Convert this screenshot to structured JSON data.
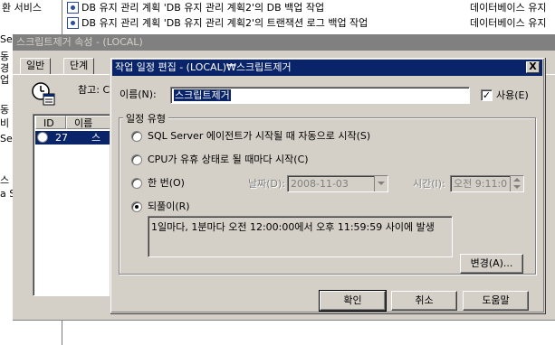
{
  "background": {
    "rows": [
      {
        "col1": "환 서비스",
        "job": "DB 유지 관리 계획 'DB 유지 관리 계획2'의 DB 백업 작업",
        "category": "데이터베이스 유지"
      },
      {
        "col1": "",
        "job": "DB 유지 관리 계획 'DB 유지 관리 계획2'의 트랜잭션 로그 백업 작업",
        "category": "데이터베이스 유지"
      }
    ],
    "left_fragments": [
      "Se",
      "동",
      "경",
      "업",
      "동",
      "비",
      "Se",
      "스",
      "a S"
    ]
  },
  "properties_window": {
    "title": "스크립트제거 속성 - (LOCAL)",
    "tabs": [
      "일반",
      "단계"
    ],
    "note_label": "참고: C",
    "list_headers": [
      "ID",
      "이름"
    ],
    "list_row": {
      "id": "27",
      "name": "스"
    }
  },
  "dialog": {
    "title": "작업 일정 편집 - (LOCAL)₩스크립트제거",
    "close_label": "X",
    "name_label": "이름(N):",
    "name_value": "스크립트제거",
    "enabled_label": "사용(E)",
    "enabled_checked": true,
    "schedule_group_label": "일정 유형",
    "options": {
      "sql_agent_start": "SQL Server 에이전트가 시작될 때 자동으로 시작(S)",
      "cpu_idle": "CPU가 유휴 상태로 될 때마다 시작(C)",
      "once": "한 번(O)",
      "recurring": "되풀이(R)"
    },
    "selected_option": "recurring",
    "date_label": "날짜(D):",
    "date_value": "2008-11-03",
    "time_label": "시간(I):",
    "time_value": "오전  9:11:0",
    "recurring_description": "1일마다, 1분마다 오전 12:00:00에서 오후 11:59:59 사이에 발생",
    "change_button": "변경(A)...",
    "ok_button": "확인",
    "cancel_button": "취소",
    "help_button": "도움말"
  }
}
